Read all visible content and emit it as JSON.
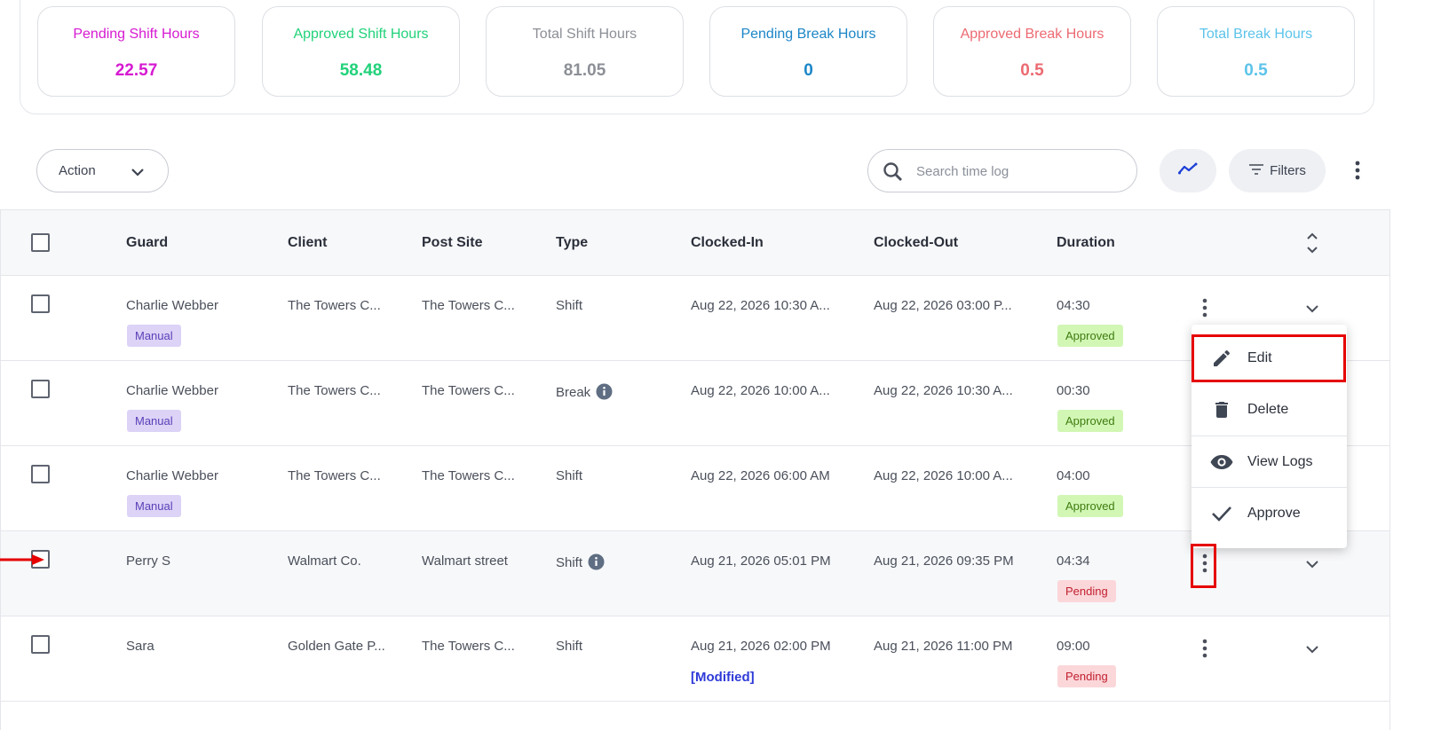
{
  "stats": [
    {
      "label": "Pending Shift Hours",
      "value": "22.57",
      "color": "#d61ad1"
    },
    {
      "label": "Approved Shift Hours",
      "value": "58.48",
      "color": "#21d27a"
    },
    {
      "label": "Total Shift Hours",
      "value": "81.05",
      "color": "#8c8f96"
    },
    {
      "label": "Pending Break Hours",
      "value": "0",
      "color": "#1b86c7"
    },
    {
      "label": "Approved Break Hours",
      "value": "0.5",
      "color": "#ec6a72"
    },
    {
      "label": "Total Break Hours",
      "value": "0.5",
      "color": "#5cc3ea"
    }
  ],
  "toolbar": {
    "action_label": "Action",
    "search_placeholder": "Search time log",
    "search_value": "",
    "filters_label": "Filters",
    "chart_icon": "trending-icon",
    "more_icon": "more-vertical-icon"
  },
  "table": {
    "headers": [
      "Guard",
      "Client",
      "Post Site",
      "Type",
      "Clocked-In",
      "Clocked-Out",
      "Duration"
    ],
    "rows": [
      {
        "guard": "Charlie Webber",
        "guard_tag": "Manual",
        "client": "The Towers C...",
        "post_site": "The Towers C...",
        "type": "Shift",
        "type_info": false,
        "clocked_in": "Aug 22, 2026 10:30 A...",
        "clocked_in_note": "",
        "clocked_out": "Aug 22, 2026 03:00 P...",
        "duration": "04:30",
        "status": "Approved"
      },
      {
        "guard": "Charlie Webber",
        "guard_tag": "Manual",
        "client": "The Towers C...",
        "post_site": "The Towers C...",
        "type": "Break",
        "type_info": true,
        "clocked_in": "Aug 22, 2026 10:00 A...",
        "clocked_in_note": "",
        "clocked_out": "Aug 22, 2026 10:30 A...",
        "duration": "00:30",
        "status": "Approved"
      },
      {
        "guard": "Charlie Webber",
        "guard_tag": "Manual",
        "client": "The Towers C...",
        "post_site": "The Towers C...",
        "type": "Shift",
        "type_info": false,
        "clocked_in": "Aug 22, 2026 06:00 AM",
        "clocked_in_note": "",
        "clocked_out": "Aug 22, 2026 10:00 A...",
        "duration": "04:00",
        "status": "Approved"
      },
      {
        "guard": "Perry S",
        "guard_tag": "",
        "client": "Walmart Co.",
        "post_site": "Walmart street",
        "type": "Shift",
        "type_info": true,
        "clocked_in": "Aug 21, 2026 05:01 PM",
        "clocked_in_note": "",
        "clocked_out": "Aug 21, 2026 09:35 PM",
        "duration": "04:34",
        "status": "Pending"
      },
      {
        "guard": "Sara",
        "guard_tag": "",
        "client": "Golden Gate P...",
        "post_site": "The Towers C...",
        "type": "Shift",
        "type_info": false,
        "clocked_in": "Aug 21, 2026 02:00 PM",
        "clocked_in_note": "[Modified]",
        "clocked_out": "Aug 21, 2026 11:00 PM",
        "duration": "09:00",
        "status": "Pending"
      }
    ]
  },
  "row_menu": {
    "items": [
      {
        "label": "Edit",
        "icon": "pencil-icon"
      },
      {
        "label": "Delete",
        "icon": "trash-icon"
      },
      {
        "label": "View Logs",
        "icon": "eye-icon"
      },
      {
        "label": "Approve",
        "icon": "check-icon"
      }
    ]
  }
}
